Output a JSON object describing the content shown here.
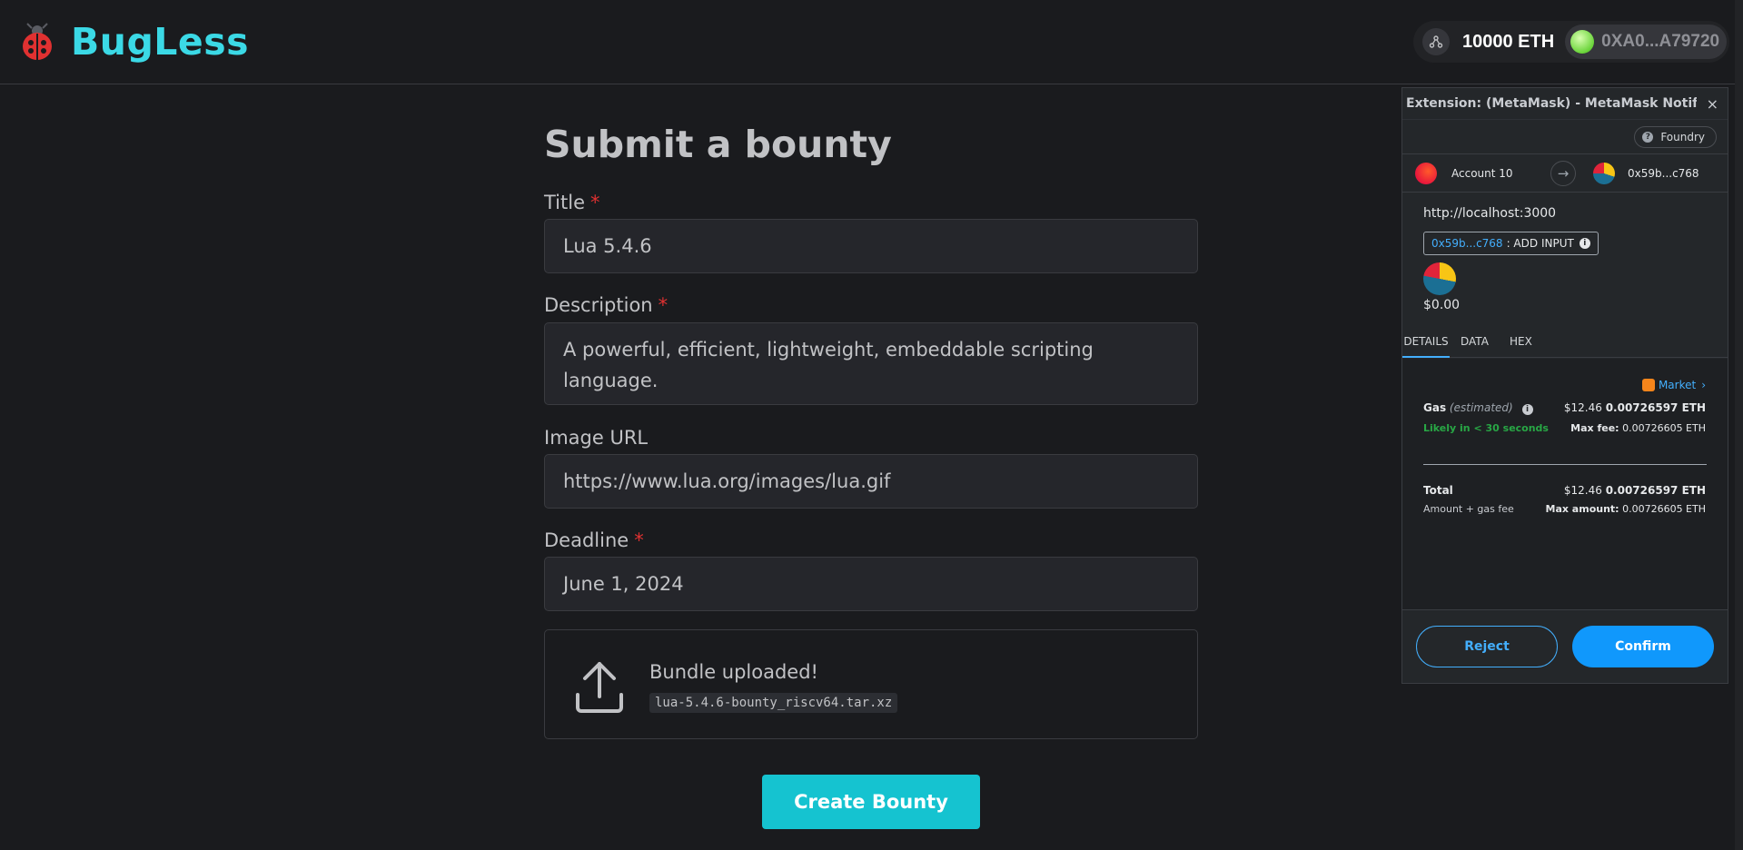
{
  "app": {
    "logo_icon": "ladybug-icon",
    "name": "BugLess",
    "accent_color": "#3bd9e6"
  },
  "wallet": {
    "network_icon": "network-icon",
    "balance": "10000 ETH",
    "address": "0XA0...A79720"
  },
  "form": {
    "title": "Submit a bounty",
    "required_mark": "*",
    "fields": {
      "title": {
        "label": "Title",
        "value": "Lua 5.4.6"
      },
      "description": {
        "label": "Description",
        "value": "A powerful, efficient, lightweight, embeddable scripting language."
      },
      "image_url": {
        "label": "Image URL",
        "value": "https://www.lua.org/images/lua.gif"
      },
      "deadline": {
        "label": "Deadline",
        "value": "June 1, 2024"
      }
    },
    "upload": {
      "icon": "upload-icon",
      "status": "Bundle uploaded!",
      "filename": "lua-5.4.6-bounty_riscv64.tar.xz"
    },
    "submit_label": "Create Bounty"
  },
  "metamask": {
    "window_title": "Extension: (MetaMask) - MetaMask Notifica...",
    "close_glyph": "×",
    "network": "Foundry",
    "from_account": "Account 10",
    "to_address": "0x59b...c768",
    "origin": "http://localhost:3000",
    "input_address": "0x59b...c768",
    "input_suffix": ": ADD INPUT",
    "value_usd": "$0.00",
    "tabs": [
      "DETAILS",
      "DATA",
      "HEX"
    ],
    "active_tab": "DETAILS",
    "market_label": "Market",
    "gas": {
      "label": "Gas",
      "estimated": "(estimated)",
      "usd": "$12.46",
      "eth": "0.00726597 ETH",
      "timing": "Likely in < 30 seconds",
      "max_fee_label": "Max fee:",
      "max_fee_value": "0.00726605 ETH"
    },
    "total": {
      "label": "Total",
      "sublabel": "Amount + gas fee",
      "usd": "$12.46",
      "eth": "0.00726597 ETH",
      "max_amount_label": "Max amount:",
      "max_amount_value": "0.00726605 ETH"
    },
    "reject_label": "Reject",
    "confirm_label": "Confirm",
    "accent_color": "#43aefc"
  }
}
